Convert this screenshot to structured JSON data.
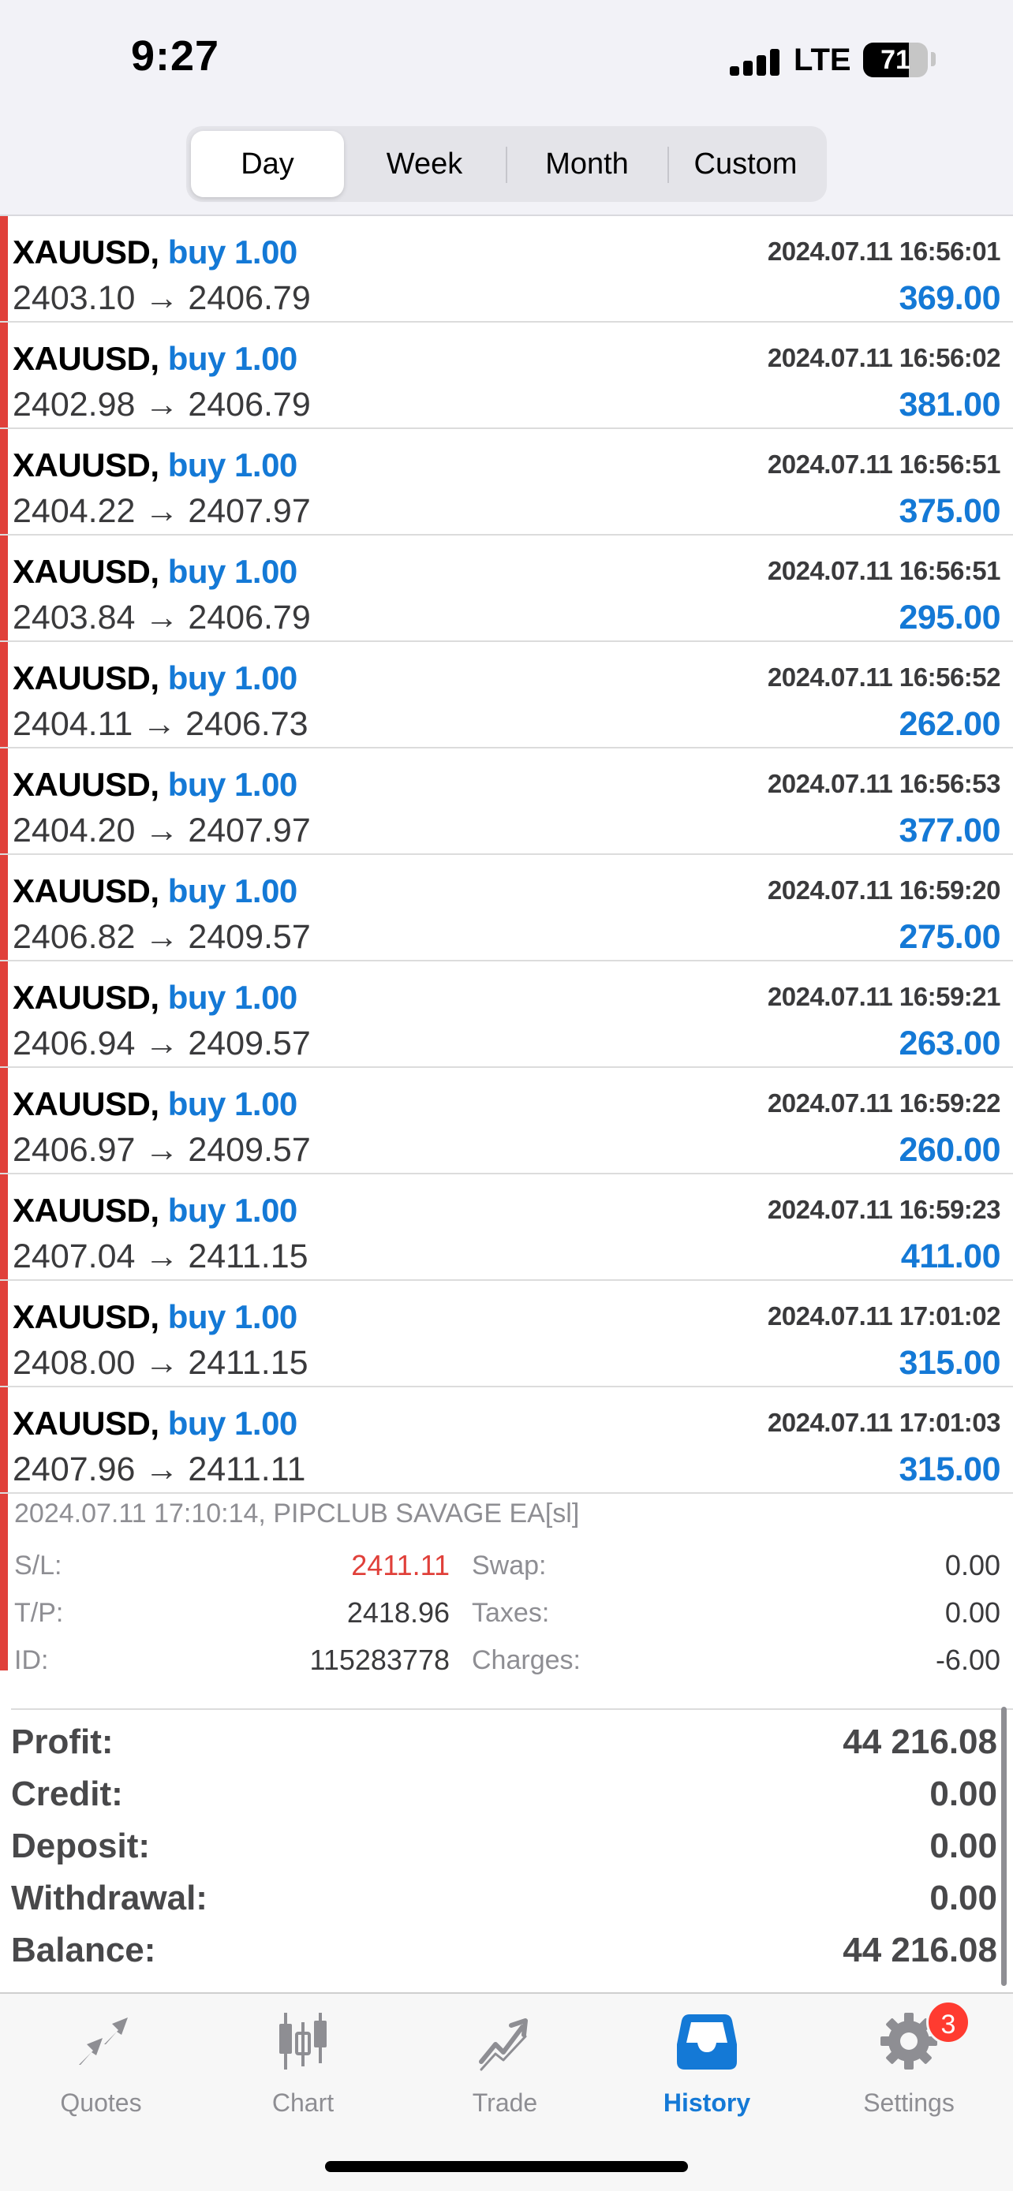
{
  "status_bar": {
    "time": "9:27",
    "network": "LTE",
    "battery": "71"
  },
  "period_tabs": [
    "Day",
    "Week",
    "Month",
    "Custom"
  ],
  "active_period": "Day",
  "deals": [
    {
      "symbol": "XAUUSD,",
      "type": "buy 1.00",
      "time": "2024.07.11 16:56:01",
      "prices": "2403.10 → 2406.79",
      "profit": "369.00"
    },
    {
      "symbol": "XAUUSD,",
      "type": "buy 1.00",
      "time": "2024.07.11 16:56:02",
      "prices": "2402.98 → 2406.79",
      "profit": "381.00"
    },
    {
      "symbol": "XAUUSD,",
      "type": "buy 1.00",
      "time": "2024.07.11 16:56:51",
      "prices": "2404.22 → 2407.97",
      "profit": "375.00"
    },
    {
      "symbol": "XAUUSD,",
      "type": "buy 1.00",
      "time": "2024.07.11 16:56:51",
      "prices": "2403.84 → 2406.79",
      "profit": "295.00"
    },
    {
      "symbol": "XAUUSD,",
      "type": "buy 1.00",
      "time": "2024.07.11 16:56:52",
      "prices": "2404.11 → 2406.73",
      "profit": "262.00"
    },
    {
      "symbol": "XAUUSD,",
      "type": "buy 1.00",
      "time": "2024.07.11 16:56:53",
      "prices": "2404.20 → 2407.97",
      "profit": "377.00"
    },
    {
      "symbol": "XAUUSD,",
      "type": "buy 1.00",
      "time": "2024.07.11 16:59:20",
      "prices": "2406.82 → 2409.57",
      "profit": "275.00"
    },
    {
      "symbol": "XAUUSD,",
      "type": "buy 1.00",
      "time": "2024.07.11 16:59:21",
      "prices": "2406.94 → 2409.57",
      "profit": "263.00"
    },
    {
      "symbol": "XAUUSD,",
      "type": "buy 1.00",
      "time": "2024.07.11 16:59:22",
      "prices": "2406.97 → 2409.57",
      "profit": "260.00"
    },
    {
      "symbol": "XAUUSD,",
      "type": "buy 1.00",
      "time": "2024.07.11 16:59:23",
      "prices": "2407.04 → 2411.15",
      "profit": "411.00"
    },
    {
      "symbol": "XAUUSD,",
      "type": "buy 1.00",
      "time": "2024.07.11 17:01:02",
      "prices": "2408.00 → 2411.15",
      "profit": "315.00"
    },
    {
      "symbol": "XAUUSD,",
      "type": "buy 1.00",
      "time": "2024.07.11 17:01:03",
      "prices": "2407.96 → 2411.11",
      "profit": "315.00"
    }
  ],
  "expanded_deal": {
    "comment": "2024.07.11 17:10:14, PIPCLUB SAVAGE EA[sl]",
    "sl_label": "S/L:",
    "sl_value": "2411.11",
    "tp_label": "T/P:",
    "tp_value": "2418.96",
    "id_label": "ID:",
    "id_value": "115283778",
    "swap_label": "Swap:",
    "swap_value": "0.00",
    "taxes_label": "Taxes:",
    "taxes_value": "0.00",
    "charges_label": "Charges:",
    "charges_value": "-6.00"
  },
  "summary": [
    {
      "label": "Profit:",
      "value": "44 216.08"
    },
    {
      "label": "Credit:",
      "value": "0.00"
    },
    {
      "label": "Deposit:",
      "value": "0.00"
    },
    {
      "label": "Withdrawal:",
      "value": "0.00"
    },
    {
      "label": "Balance:",
      "value": "44 216.08"
    }
  ],
  "tab_bar": {
    "quotes": "Quotes",
    "chart": "Chart",
    "trade": "Trade",
    "history": "History",
    "settings": "Settings",
    "settings_badge": "3",
    "active": "History"
  },
  "colors": {
    "accent_blue": "#1479d6",
    "loss_red": "#e0403a",
    "badge_red": "#ff3b30"
  }
}
